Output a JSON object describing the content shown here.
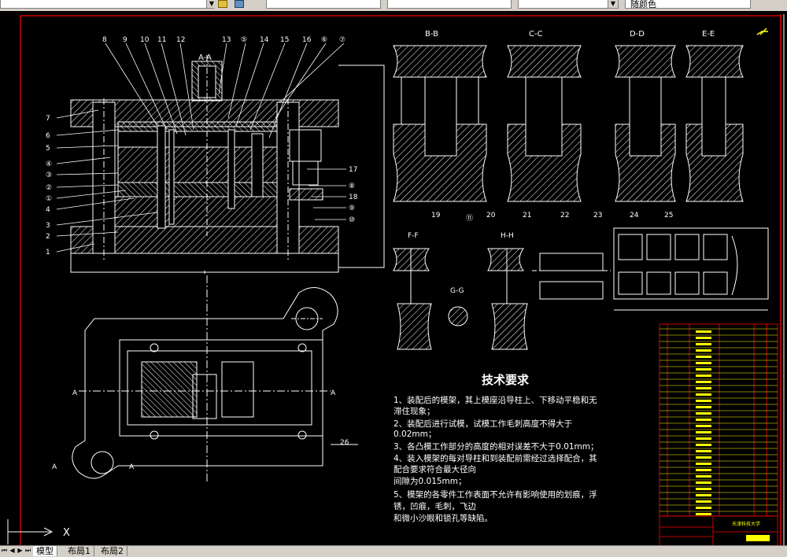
{
  "toolbar": {
    "combos": [
      "",
      "",
      "",
      "",
      "",
      "",
      "随颜色"
    ],
    "layer_icon": "layer-state-icon",
    "layer_props_icon": "layer-properties-icon"
  },
  "canvas": {
    "background": "#000000",
    "border_color": "#ff0000",
    "line_color": "#ffffff",
    "hatch_color": "#ffffff",
    "dim_color": "#ffffff",
    "title_block_color": "#ffff00"
  },
  "views": {
    "section_aa": "A-A",
    "section_bb": "B-B",
    "section_cc": "C-C",
    "section_dd": "D-D",
    "section_ee": "E-E",
    "section_ff": "F-F",
    "section_gg": "G-G",
    "section_hh": "H-H",
    "plan_cut_left": "A",
    "plan_cut_right": "A"
  },
  "balloons_top": [
    "8",
    "9",
    "10",
    "11",
    "12",
    "13",
    "⑤",
    "14",
    "15",
    "16",
    "⑥",
    "⑦"
  ],
  "balloons_left": [
    "7",
    "6",
    "5",
    "④",
    "③",
    "②",
    "①",
    "4",
    "3",
    "2",
    "1"
  ],
  "balloons_right": [
    "17",
    "⑧",
    "18",
    "⑨",
    "⑩"
  ],
  "balloons_sections": [
    "20",
    "22",
    "23",
    "24",
    "25",
    "19",
    "21",
    "⑪",
    "26"
  ],
  "tech_req": {
    "title": "技术要求",
    "items": [
      "1、装配后的模架，其上模座沿导柱上、下移动平稳和无",
      "滞住现象；",
      "2、装配后进行试模，试模工作毛刺高度不得大于",
      "0.02mm；",
      "3、各凸模工作部分的高度的相对误差不大于0.01mm；",
      "4、装入模架的每对导柱和到装配前需经过选择配合，其",
      "配合要求符合最大径向",
      "间隙为0.015mm；",
      "5、模架的各零件工作表面不允许有影响使用的划痕，浮",
      "锈，凹痕，毛刺，飞边",
      "和微小沙眼和锁孔等缺陷。"
    ]
  },
  "title_block": {
    "school": "天津科技大学"
  },
  "ucs": {
    "x_label": "X"
  },
  "tabs": {
    "items": [
      "模型",
      "布局1",
      "布局2"
    ],
    "active": 0
  }
}
